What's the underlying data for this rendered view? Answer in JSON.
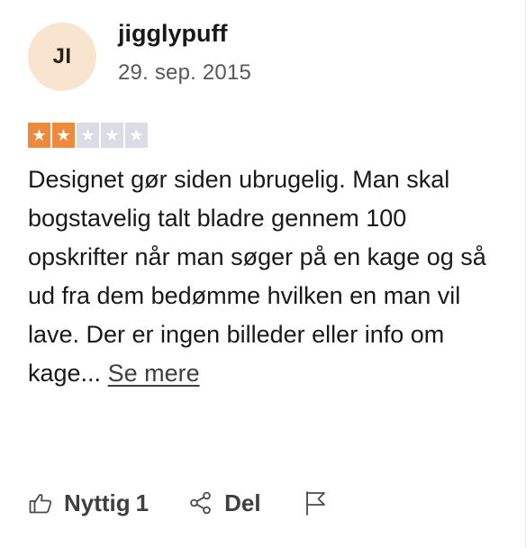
{
  "review": {
    "avatar_initials": "JI",
    "username": "jigglypuff",
    "date": "29. sep. 2015",
    "rating": {
      "filled": 2,
      "total": 5,
      "filled_color": "#ee8a3c",
      "empty_color": "#dcdce6"
    },
    "text": "Designet gør siden ubrugelig. Man skal bogstavelig talt bladre gennem 100 opskrifter når man søger på en kage og så ud fra dem bedømme hvilken en man vil lave. Der er ingen billeder eller info om kage...",
    "see_more_label": "Se mere"
  },
  "actions": {
    "helpful_label": "Nyttig",
    "helpful_count": "1",
    "share_label": "Del",
    "icons": [
      "thumbs-up-icon",
      "share-icon",
      "flag-icon"
    ]
  },
  "colors": {
    "accent": "#ee8a3c",
    "avatar_bg": "#f9e4cf",
    "text": "#191919",
    "muted": "#585858"
  }
}
